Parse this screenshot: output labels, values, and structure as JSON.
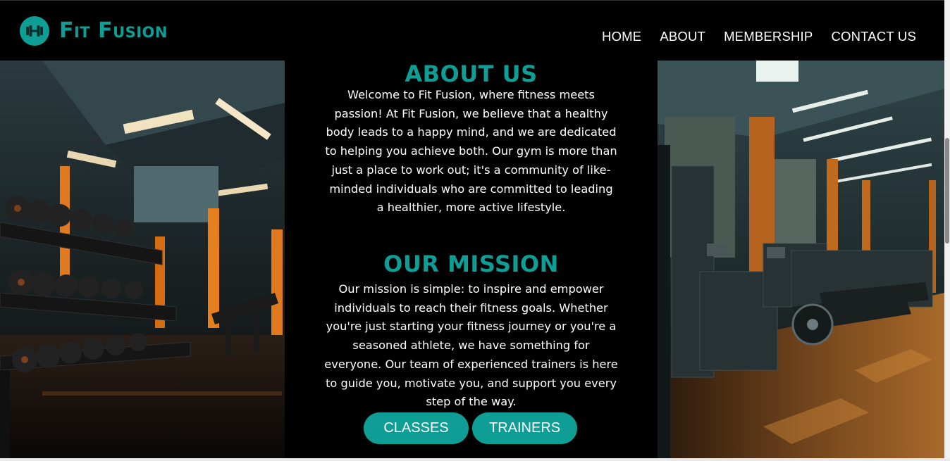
{
  "brand": {
    "name": "Fit Fusion",
    "icon": "dumbbell-icon",
    "accent_color": "#0e9e95"
  },
  "nav": {
    "items": [
      {
        "label": "HOME"
      },
      {
        "label": "ABOUT"
      },
      {
        "label": "MEMBERSHIP"
      },
      {
        "label": "CONTACT US"
      }
    ]
  },
  "about": {
    "title": "ABOUT US",
    "text": "Welcome to Fit Fusion, where fitness meets passion! At Fit Fusion, we believe that a healthy body leads to a happy mind, and we are dedicated to helping you achieve both. Our gym is more than just a place to work out; it's a community of like-minded individuals who are committed to leading a healthier, more active lifestyle."
  },
  "mission": {
    "title": "OUR MISSION",
    "text": "Our mission is simple: to inspire and empower individuals to reach their fitness goals. Whether you're just starting your fitness journey or you're a seasoned athlete, we have something for everyone. Our team of experienced trainers is here to guide you, motivate you, and support you every step of the way."
  },
  "buttons": {
    "classes": "CLASSES",
    "trainers": "TRAINERS"
  }
}
